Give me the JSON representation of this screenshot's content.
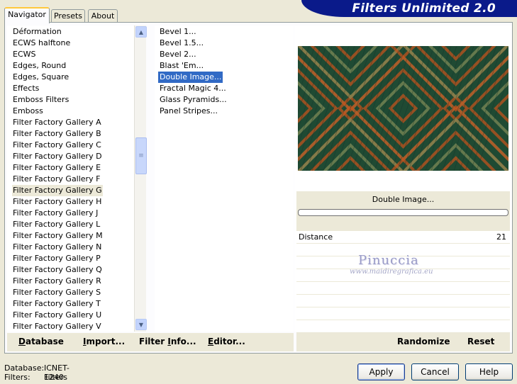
{
  "app": {
    "title": "Filters Unlimited 2.0"
  },
  "tabs": [
    {
      "label": "Navigator",
      "active": true
    },
    {
      "label": "Presets",
      "active": false
    },
    {
      "label": "About",
      "active": false
    }
  ],
  "categories": {
    "items": [
      "Déformation",
      "ECWS halftone",
      "ECWS",
      "Edges, Round",
      "Edges, Square",
      "Effects",
      "Emboss Filters",
      "Emboss",
      "Filter Factory Gallery A",
      "Filter Factory Gallery B",
      "Filter Factory Gallery C",
      "Filter Factory Gallery D",
      "Filter Factory Gallery E",
      "Filter Factory Gallery F",
      "Filter Factory Gallery G",
      "Filter Factory Gallery H",
      "Filter Factory Gallery J",
      "Filter Factory Gallery L",
      "Filter Factory Gallery M",
      "Filter Factory Gallery N",
      "Filter Factory Gallery P",
      "Filter Factory Gallery Q",
      "Filter Factory Gallery R",
      "Filter Factory Gallery S",
      "Filter Factory Gallery T",
      "Filter Factory Gallery U",
      "Filter Factory Gallery V"
    ],
    "selected": "Filter Factory Gallery G"
  },
  "filters": {
    "items": [
      "Bevel 1...",
      "Bevel 1.5...",
      "Bevel 2...",
      "Blast 'Em...",
      "Double Image...",
      "Fractal Magic 4...",
      "Glass Pyramids...",
      "Panel Stripes..."
    ],
    "selected": "Double Image..."
  },
  "preview": {
    "filter_name": "Double Image...",
    "progress": 0,
    "colors": [
      "#1f4a33",
      "#c0531e",
      "#7d8a57",
      "#16302a"
    ]
  },
  "params": [
    {
      "label": "Distance",
      "value": "21"
    }
  ],
  "watermark": {
    "name": "Pinuccia",
    "url": "www.maidiregrafica.eu"
  },
  "toolbar": {
    "database": {
      "ul": "D",
      "rest": "atabase"
    },
    "import": {
      "ul": "I",
      "rest": "mport..."
    },
    "filter_info": {
      "pre": "Filter ",
      "ul": "I",
      "rest": "nfo..."
    },
    "editor": {
      "ul": "E",
      "rest": "ditor..."
    },
    "randomize": "Randomize",
    "reset": "Reset"
  },
  "status": {
    "database_label": "Database:",
    "database_value": "ICNET-Filters",
    "filters_label": "Filters:",
    "filters_value": "1240"
  },
  "buttons": {
    "apply": "Apply",
    "cancel": "Cancel",
    "help": "Help"
  }
}
